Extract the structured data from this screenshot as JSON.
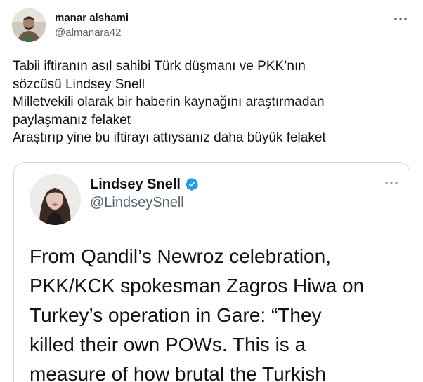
{
  "author": {
    "display_name": "manar alshami",
    "handle": "@almanara42",
    "avatar_icon": "profile-photo-man"
  },
  "tweet": {
    "lines": [
      "Tabii iftiranın asıl sahibi Türk düşmanı ve PKK’nın",
      "sözcüsü Lindsey Snell",
      "Milletvekili olarak bir haberin kaynağını araştırmadan",
      "paylaşmanız felaket",
      "Araştırıp yine bu iftirayı attıysanız daha büyük felaket"
    ]
  },
  "quoted_tweet": {
    "display_name": "Lindsey Snell",
    "handle": "@LindseySnell",
    "verified": true,
    "verified_color": "#1d9bf0",
    "avatar_icon": "profile-photo-woman",
    "lines": [
      "From Qandil’s Newroz celebration,",
      "PKK/KCK spokesman Zagros Hiwa on",
      "Turkey’s operation in Gare: “They",
      "killed their own POWs. This is a",
      "measure of how brutal the Turkish"
    ]
  },
  "colors": {
    "text_primary": "#0f1419",
    "text_secondary": "#536471",
    "border": "#cfd9de"
  }
}
